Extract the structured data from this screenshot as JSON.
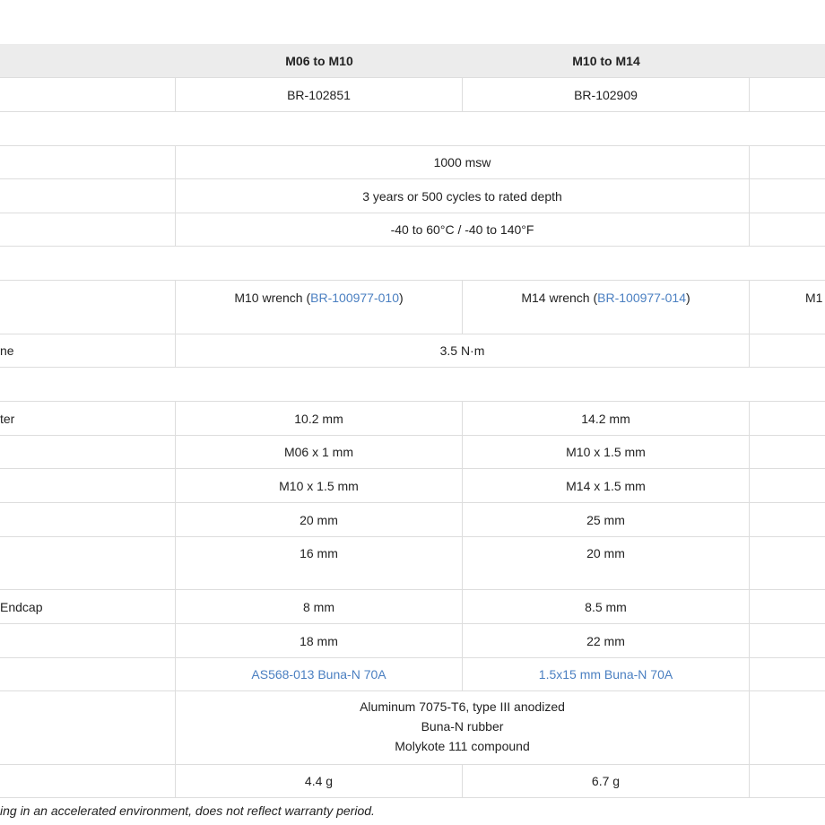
{
  "header": {
    "col1": "M06 to M10",
    "col2": "M10 to M14"
  },
  "rows": {
    "part_number": {
      "col1": "BR-102851",
      "col2": "BR-102909"
    },
    "depth_rating": "1000 msw",
    "life": "3 years or 500 cycles to rated depth",
    "temperature": "-40 to 60°C / -40 to 140°F",
    "wrench": {
      "col1_prefix": "M10 wrench (",
      "col1_link": "BR-100977-010",
      "col1_suffix": ")",
      "col2_prefix": "M14 wrench (",
      "col2_link": "BR-100977-014",
      "col2_suffix": ")",
      "col3_cut": "M1"
    },
    "torque": {
      "label_cut": "ne",
      "value": "3.5 N·m"
    },
    "diameter": {
      "label_cut": "ter",
      "col1": "10.2 mm",
      "col2": "14.2 mm"
    },
    "thread_small": {
      "col1": "M06 x 1 mm",
      "col2": "M10 x 1.5 mm"
    },
    "thread_large": {
      "col1": "M10 x 1.5 mm",
      "col2": "M14 x 1.5 mm"
    },
    "length": {
      "col1": "20 mm",
      "col2": "25 mm"
    },
    "hex_size": {
      "col1": "16 mm",
      "col2": "20 mm"
    },
    "endcap": {
      "label_cut": "Endcap",
      "col1": "8 mm",
      "col2": "8.5 mm"
    },
    "height": {
      "col1": "18 mm",
      "col2": "22 mm"
    },
    "oring": {
      "col1": "AS568-013 Buna-N 70A",
      "col2": "1.5x15 mm Buna-N 70A"
    },
    "materials": {
      "line1": "Aluminum 7075-T6, type III anodized",
      "line2": "Buna-N rubber",
      "line3": "Molykote 111 compound"
    },
    "weight": {
      "col1": "4.4 g",
      "col2": "6.7 g"
    }
  },
  "footnote": "ing in an accelerated environment, does not reflect warranty period.",
  "colors": {
    "header_bg": "#ececec",
    "border": "#dddddd",
    "link": "#4a7fc1",
    "text": "#222222"
  }
}
